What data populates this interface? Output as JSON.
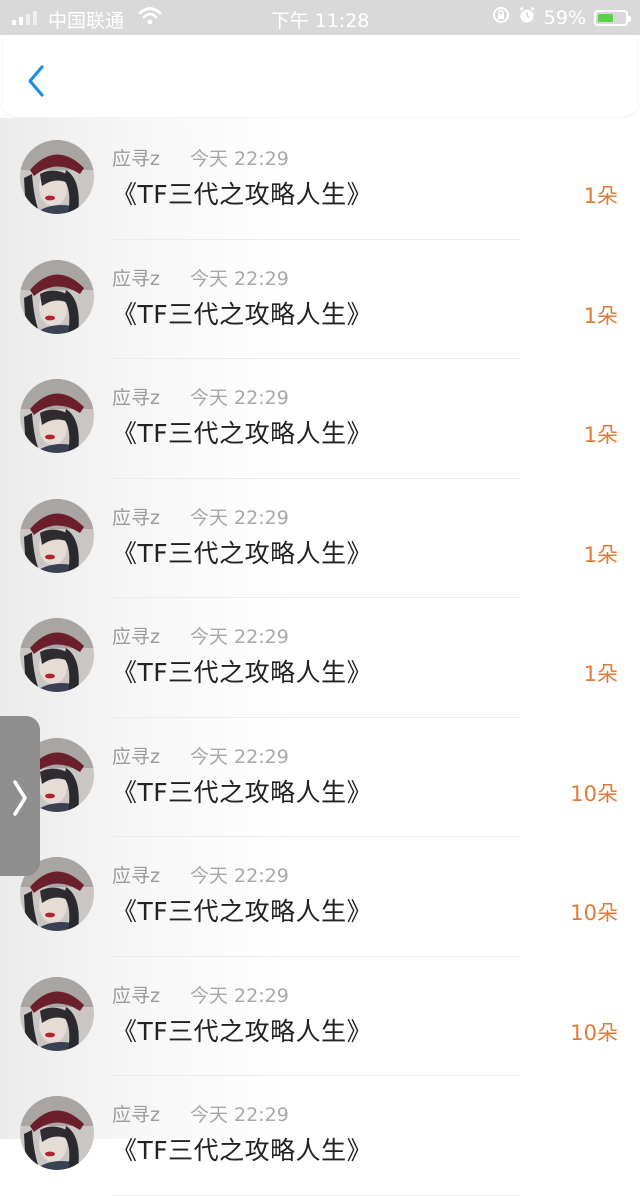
{
  "status_bar": {
    "carrier": "中国联通",
    "time": "下午 11:28",
    "battery_percent": "59%",
    "battery_level": 0.59,
    "icons": [
      "signal-icon",
      "wifi-icon",
      "orientation-lock-icon",
      "alarm-icon",
      "battery-icon"
    ]
  },
  "nav": {
    "back_icon": "chevron-left-icon"
  },
  "gift_list": {
    "items": [
      {
        "sender": "应寻z",
        "time": "今天 22:29",
        "title": "《TF三代之攻略人生》",
        "count": "1朵"
      },
      {
        "sender": "应寻z",
        "time": "今天 22:29",
        "title": "《TF三代之攻略人生》",
        "count": "1朵"
      },
      {
        "sender": "应寻z",
        "time": "今天 22:29",
        "title": "《TF三代之攻略人生》",
        "count": "1朵"
      },
      {
        "sender": "应寻z",
        "time": "今天 22:29",
        "title": "《TF三代之攻略人生》",
        "count": "1朵"
      },
      {
        "sender": "应寻z",
        "time": "今天 22:29",
        "title": "《TF三代之攻略人生》",
        "count": "1朵"
      },
      {
        "sender": "应寻z",
        "time": "今天 22:29",
        "title": "《TF三代之攻略人生》",
        "count": "10朵"
      },
      {
        "sender": "应寻z",
        "time": "今天 22:29",
        "title": "《TF三代之攻略人生》",
        "count": "10朵"
      },
      {
        "sender": "应寻z",
        "time": "今天 22:29",
        "title": "《TF三代之攻略人生》",
        "count": "10朵"
      },
      {
        "sender": "应寻z",
        "time": "今天 22:29",
        "title": "《TF三代之攻略人生》",
        "count": ""
      }
    ]
  },
  "side_handle": {
    "icon": "chevron-right-icon"
  },
  "colors": {
    "accent_blue": "#1b8fe8",
    "count_orange": "#e07a36",
    "status_bar_bg": "#d9d9d9"
  }
}
